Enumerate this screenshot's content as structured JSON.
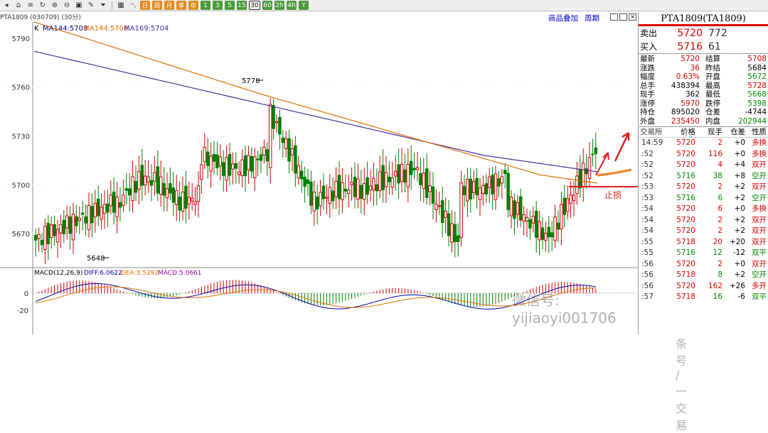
{
  "toolbar": {
    "icons": [
      "back-icon",
      "home-icon",
      "list-icon",
      "refresh-icon",
      "zoom-in-icon",
      "zoom-out-icon",
      "window-icon",
      "pen-icon",
      "funnel-icon"
    ],
    "period_buttons": [
      {
        "label": "日",
        "style": "o"
      },
      {
        "label": "周",
        "style": "o"
      },
      {
        "label": "月",
        "style": "o"
      },
      {
        "label": "季",
        "style": "o"
      },
      {
        "label": "年",
        "style": "o"
      },
      {
        "label": "1",
        "style": "g"
      },
      {
        "label": "3",
        "style": "g"
      },
      {
        "label": "5",
        "style": "g"
      },
      {
        "label": "15",
        "style": "g"
      },
      {
        "label": "30",
        "style": "sel"
      },
      {
        "label": "60",
        "style": "g"
      },
      {
        "label": "2h",
        "style": "g"
      },
      {
        "label": "4h",
        "style": "g"
      },
      {
        "label": "Y",
        "style": "g"
      }
    ]
  },
  "chart": {
    "symbol_label": "PTA1809 (030709) (30分)",
    "ma_legend": [
      {
        "text": "MA144:5708",
        "color": "#000080"
      },
      {
        "text": "MA144:5708",
        "color": "#e07000"
      },
      {
        "text": "MA169:5704",
        "color": "#4030a0"
      }
    ],
    "k_label": "K",
    "links": {
      "add": "商品叠加",
      "cycle": "周期"
    },
    "yticks": [
      "5790",
      "5760",
      "5730",
      "5700",
      "5670"
    ],
    "high_label": "5778",
    "low_label": "5648",
    "stop_label": "止损",
    "macd_title": "MACD(12,26,9)",
    "macd_diff": "DIFF:6.0622",
    "macd_dea": "DEA:3.5292",
    "macd_val": "MACD:5.0661",
    "macd_yticks": [
      "0",
      "-20"
    ],
    "watermark1": "微信号: yijiaoyi001706",
    "watermark2": "头条号 / 一交易"
  },
  "colors": {
    "up": "#d00000",
    "down": "#008000",
    "ma1": "#4030a0",
    "ma2": "#e07000"
  },
  "panel": {
    "title": "PTA1809(TA1809)",
    "ask_label": "卖出",
    "ask_price": "5720",
    "ask_vol": "772",
    "bid_label": "买入",
    "bid_price": "5716",
    "bid_vol": "61",
    "stats": [
      {
        "l1": "最新",
        "v1": "5720",
        "c1": "red",
        "l2": "结算",
        "v2": "5708",
        "c2": "red"
      },
      {
        "l1": "涨跌",
        "v1": "36",
        "c1": "red",
        "l2": "昨结",
        "v2": "5684",
        "c2": "blk"
      },
      {
        "l1": "幅度",
        "v1": "0.63%",
        "c1": "red",
        "l2": "开盘",
        "v2": "5672",
        "c2": "grn"
      },
      {
        "l1": "总手",
        "v1": "438394",
        "c1": "blk",
        "l2": "最高",
        "v2": "5728",
        "c2": "red"
      },
      {
        "l1": "现手",
        "v1": "362",
        "c1": "blk",
        "l2": "最低",
        "v2": "5668",
        "c2": "grn"
      },
      {
        "l1": "涨停",
        "v1": "5970",
        "c1": "red",
        "l2": "跌停",
        "v2": "5398",
        "c2": "grn"
      },
      {
        "l1": "持仓",
        "v1": "895020",
        "c1": "blk",
        "l2": "仓差",
        "v2": "-4744",
        "c2": "blk"
      },
      {
        "l1": "外盘",
        "v1": "235450",
        "c1": "red",
        "l2": "内盘",
        "v2": "202944",
        "c2": "grn"
      }
    ],
    "tick_headers": [
      "交易所",
      "价格",
      "现手",
      "仓差",
      "性质"
    ],
    "ticks": [
      {
        "t": "14:59",
        "p": "5720",
        "v": "2",
        "d": "+0",
        "n": "多换",
        "pc": "red",
        "nc": "red"
      },
      {
        "t": ":52",
        "p": "5720",
        "v": "116",
        "d": "+0",
        "n": "多换",
        "pc": "red",
        "nc": "red"
      },
      {
        "t": ":52",
        "p": "5720",
        "v": "4",
        "d": "+4",
        "n": "双开",
        "pc": "red",
        "nc": "red"
      },
      {
        "t": ":52",
        "p": "5716",
        "v": "38",
        "d": "+8",
        "n": "空开",
        "pc": "grn",
        "nc": "grn"
      },
      {
        "t": ":53",
        "p": "5720",
        "v": "2",
        "d": "+2",
        "n": "双开",
        "pc": "red",
        "nc": "red"
      },
      {
        "t": ":53",
        "p": "5716",
        "v": "6",
        "d": "+2",
        "n": "空开",
        "pc": "grn",
        "nc": "grn"
      },
      {
        "t": ":54",
        "p": "5720",
        "v": "6",
        "d": "+0",
        "n": "多换",
        "pc": "red",
        "nc": "red"
      },
      {
        "t": ":54",
        "p": "5720",
        "v": "2",
        "d": "+2",
        "n": "双开",
        "pc": "red",
        "nc": "red"
      },
      {
        "t": ":54",
        "p": "5720",
        "v": "2",
        "d": "+2",
        "n": "双开",
        "pc": "red",
        "nc": "red"
      },
      {
        "t": ":55",
        "p": "5718",
        "v": "20",
        "d": "+20",
        "n": "双开",
        "pc": "red",
        "nc": "red"
      },
      {
        "t": ":55",
        "p": "5716",
        "v": "12",
        "d": "-12",
        "n": "双平",
        "pc": "grn",
        "nc": "grn"
      },
      {
        "t": ":56",
        "p": "5720",
        "v": "2",
        "d": "+0",
        "n": "双开",
        "pc": "red",
        "nc": "red"
      },
      {
        "t": ":56",
        "p": "5718",
        "v": "8",
        "d": "+2",
        "n": "空开",
        "pc": "red",
        "nc": "grn"
      },
      {
        "t": ":56",
        "p": "5720",
        "v": "162",
        "d": "+26",
        "n": "多开",
        "pc": "red",
        "nc": "red"
      },
      {
        "t": ":57",
        "p": "5718",
        "v": "16",
        "d": "-6",
        "n": "双平",
        "pc": "red",
        "nc": "grn"
      }
    ]
  }
}
